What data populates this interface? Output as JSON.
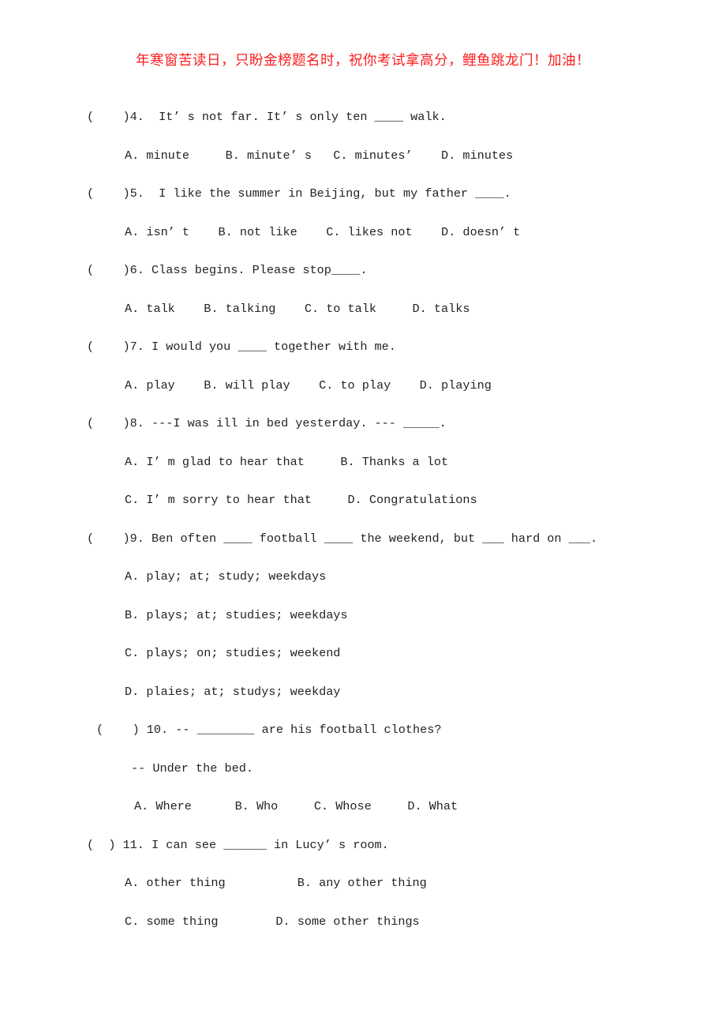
{
  "banner": {
    "text": "年寒窗苦读日，只盼金榜题名时，祝你考试拿高分，鲤鱼跳龙门！加油！",
    "color": "#fb1c1c"
  },
  "questions": [
    {
      "marker": "(    )4.",
      "stem": "(    )4.  It’ s not far. It’ s only ten ____ walk.",
      "option_rows": [
        "A. minute     B. minute’ s   C. minutes’    D. minutes"
      ]
    },
    {
      "marker": "(    )5.",
      "stem": "(    )5.  I like the summer in Beijing, but my father ____.",
      "option_rows": [
        "A. isn’ t    B. not like    C. likes not    D. doesn’ t"
      ]
    },
    {
      "marker": "(    )6.",
      "stem": "(    )6. Class begins. Please stop____.",
      "option_rows": [
        "A. talk    B. talking    C. to talk     D. talks"
      ]
    },
    {
      "marker": "(    )7.",
      "stem": "(    )7. I would you ____ together with me.",
      "option_rows": [
        "A. play    B. will play    C. to play    D. playing"
      ]
    },
    {
      "marker": "(    )8.",
      "stem": "(    )8. ---I was ill in bed yesterday. --- _____.",
      "option_rows": [
        "A. I’ m glad to hear that     B. Thanks a lot",
        "C. I’ m sorry to hear that     D. Congratulations"
      ]
    },
    {
      "marker": "(    )9.",
      "stem": "(    )9. Ben often ____ football ____ the weekend, but ___ hard on ___.",
      "option_rows": [
        "A. play; at; study; weekdays",
        "B. plays; at; studies; weekdays",
        "C. plays; on; studies; weekend",
        "D. plaies; at; studys; weekday"
      ]
    },
    {
      "marker": "(    ) 10.",
      "stem": "(    ) 10. -- ________ are his football clothes?",
      "reply": "-- Under the bed.",
      "option_rows": [
        "A. Where      B. Who     C. Whose     D. What"
      ]
    },
    {
      "marker": "(  ) 11.",
      "stem": "(  ) 11. I can see ______ in Lucy’ s room.",
      "option_rows": [
        "A. other thing          B. any other thing",
        "C. some thing        D. some other things"
      ]
    }
  ]
}
